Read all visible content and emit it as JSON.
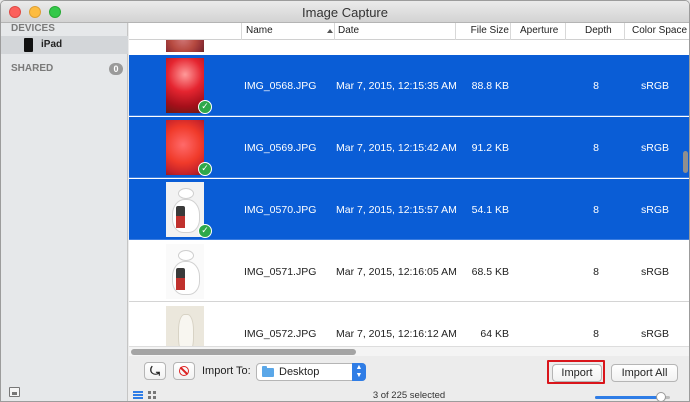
{
  "window": {
    "title": "Image Capture"
  },
  "sidebar": {
    "devices_heading": "DEVICES",
    "device_label": "iPad",
    "shared_heading": "SHARED",
    "shared_count": "0"
  },
  "table": {
    "columns": [
      "Name",
      "Date",
      "File Size",
      "Aperture",
      "Depth",
      "Color Space"
    ],
    "rows": [
      {
        "name": "IMG_0568.JPG",
        "date": "Mar 7, 2015, 12:15:35 AM",
        "size": "88.8 KB",
        "depth": "8",
        "color": "sRGB",
        "selected": true,
        "imported": true
      },
      {
        "name": "IMG_0569.JPG",
        "date": "Mar 7, 2015, 12:15:42 AM",
        "size": "91.2 KB",
        "depth": "8",
        "color": "sRGB",
        "selected": true,
        "imported": true
      },
      {
        "name": "IMG_0570.JPG",
        "date": "Mar 7, 2015, 12:15:57 AM",
        "size": "54.1 KB",
        "depth": "8",
        "color": "sRGB",
        "selected": true,
        "imported": true
      },
      {
        "name": "IMG_0571.JPG",
        "date": "Mar 7, 2015, 12:16:05 AM",
        "size": "68.5 KB",
        "depth": "8",
        "color": "sRGB",
        "selected": false,
        "imported": false
      },
      {
        "name": "IMG_0572.JPG",
        "date": "Mar 7, 2015, 12:16:12 AM",
        "size": "64 KB",
        "depth": "8",
        "color": "sRGB",
        "selected": false,
        "imported": false
      }
    ]
  },
  "toolbar": {
    "import_to_label": "Import To:",
    "destination": "Desktop",
    "import_label": "Import",
    "import_all_label": "Import All",
    "status": "3 of 225 selected",
    "zoom_level": 0.88
  },
  "colors": {
    "selection": "#0a5dd6",
    "highlight": "#d9151b",
    "check": "#2ea84a"
  }
}
